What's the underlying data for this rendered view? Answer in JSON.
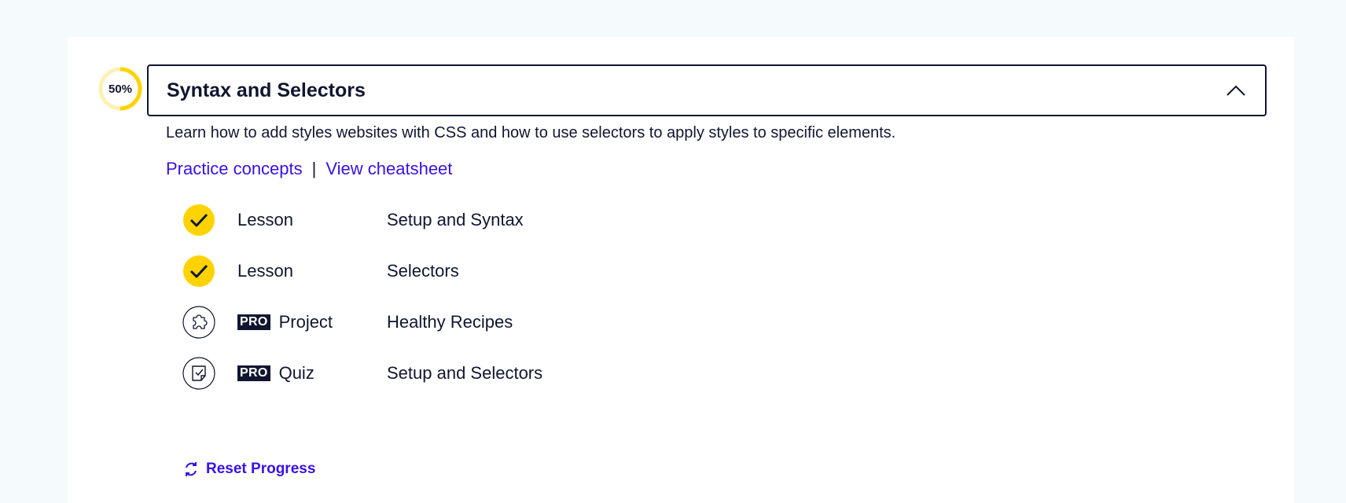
{
  "module": {
    "progress_label": "50%",
    "progress_fraction": 0.5,
    "title": "Syntax and Selectors",
    "description": "Learn how to add styles websites with CSS and how to use selectors to apply styles to specific elements.",
    "links": {
      "practice": "Practice concepts",
      "separator": "|",
      "cheatsheet": "View cheatsheet"
    },
    "items": [
      {
        "status": "completed",
        "icon": "check-icon",
        "pro": false,
        "type": "Lesson",
        "name": "Setup and Syntax"
      },
      {
        "status": "completed",
        "icon": "check-icon",
        "pro": false,
        "type": "Lesson",
        "name": "Selectors"
      },
      {
        "status": "incomplete",
        "icon": "puzzle-icon",
        "pro": true,
        "pro_label": "PRO",
        "type": "Project",
        "name": "Healthy Recipes"
      },
      {
        "status": "incomplete",
        "icon": "quiz-note-icon",
        "pro": true,
        "pro_label": "PRO",
        "type": "Quiz",
        "name": "Setup and Selectors"
      }
    ],
    "reset_label": "Reset Progress"
  },
  "colors": {
    "background": "#f5fbfd",
    "card": "#ffffff",
    "text": "#10162f",
    "link": "#3a10e5",
    "accent_yellow": "#ffd300",
    "progress_track": "#fff0b3"
  }
}
